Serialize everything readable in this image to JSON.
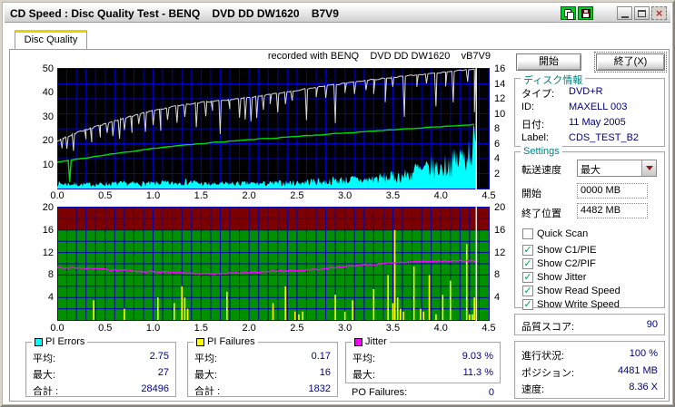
{
  "window": {
    "title": "CD Speed : Disc Quality Test - BENQ    DVD DD DW1620    B7V9"
  },
  "titlebar_icons": [
    "copy-document-icon",
    "save-icon",
    "minimize-icon",
    "maximize-icon",
    "close-icon"
  ],
  "tabs": [
    {
      "label": "Disc Quality"
    }
  ],
  "chart_header": "recorded with BENQ    DVD DD DW1620    vB7V9",
  "actions": {
    "start": "開始",
    "exit": "終了(X)"
  },
  "disc_info": {
    "title": "ディスク情報",
    "rows": [
      {
        "label": "タイプ:",
        "value": "DVD+R"
      },
      {
        "label": "ID:",
        "value": "MAXELL 003"
      },
      {
        "label": "日付:",
        "value": "11 May 2005"
      },
      {
        "label": "Label:",
        "value": "CDS_TEST_B2"
      }
    ]
  },
  "settings": {
    "title": "Settings",
    "speed_label": "転送速度",
    "speed_value": "最大",
    "start_label": "開始",
    "start_value": "0000 MB",
    "end_label": "終了位置",
    "end_value": "4482 MB",
    "checkboxes": [
      {
        "label": "Quick Scan",
        "checked": false
      },
      {
        "label": "Show C1/PIE",
        "checked": true
      },
      {
        "label": "Show C2/PIF",
        "checked": true
      },
      {
        "label": "Show Jitter",
        "checked": true
      },
      {
        "label": "Show Read Speed",
        "checked": true
      },
      {
        "label": "Show Write Speed",
        "checked": true
      }
    ]
  },
  "quality": {
    "label": "品質スコア:",
    "value": "90"
  },
  "progress": {
    "rows": [
      {
        "label": "進行状況:",
        "value": "100 %"
      },
      {
        "label": "ポジション:",
        "value": "4481 MB"
      },
      {
        "label": "速度:",
        "value": "8.36 X"
      }
    ]
  },
  "stats": {
    "pi_errors": {
      "title": "PI Errors",
      "color": "#00ffff",
      "rows": [
        {
          "label": "平均:",
          "value": "2.75"
        },
        {
          "label": "最大:",
          "value": "27"
        },
        {
          "label": "合計 :",
          "value": "28496"
        }
      ]
    },
    "pi_failures": {
      "title": "PI Failures",
      "color": "#ffff00",
      "rows": [
        {
          "label": "平均:",
          "value": "0.17"
        },
        {
          "label": "最大:",
          "value": "16"
        },
        {
          "label": "合計 :",
          "value": "1832"
        }
      ]
    },
    "jitter": {
      "title": "Jitter",
      "color": "#ff00ff",
      "rows": [
        {
          "label": "平均:",
          "value": "9.03 %"
        },
        {
          "label": "最大:",
          "value": "11.3 %"
        }
      ]
    },
    "po_failures": {
      "label": "PO Failures:",
      "value": "0"
    }
  },
  "chart_data": [
    {
      "type": "area",
      "title": "PI Errors / Speed vs position (GB)",
      "x_range": [
        0,
        4.5
      ],
      "end_x": 4.37,
      "x_ticks": [
        "0.0",
        "0.5",
        "1.0",
        "1.5",
        "2.0",
        "2.5",
        "3.0",
        "3.5",
        "4.0",
        "4.5"
      ],
      "left_axis": {
        "range": [
          0,
          50
        ],
        "ticks": [
          50,
          40,
          30,
          20,
          10
        ]
      },
      "right_axis": {
        "range": [
          0,
          16
        ],
        "ticks": [
          16,
          14,
          12,
          10,
          8,
          6,
          4,
          2
        ]
      },
      "grid": {
        "v_step": 0.1,
        "h_step_right": 2,
        "color": "#0000c8"
      },
      "bg": "#000000",
      "series": [
        {
          "name": "PI Errors",
          "type": "noise-area",
          "color": "#00ffff",
          "envelope": [
            [
              0,
              3
            ],
            [
              0.2,
              2.5
            ],
            [
              0.4,
              2.5
            ],
            [
              0.6,
              3
            ],
            [
              0.8,
              3
            ],
            [
              1.0,
              3
            ],
            [
              1.1,
              3.5
            ],
            [
              1.2,
              3
            ],
            [
              1.3,
              4
            ],
            [
              1.4,
              4
            ],
            [
              1.5,
              3
            ],
            [
              1.6,
              2.5
            ],
            [
              1.8,
              3
            ],
            [
              2.0,
              3
            ],
            [
              2.2,
              3
            ],
            [
              2.4,
              3.5
            ],
            [
              2.5,
              3.5
            ],
            [
              2.6,
              4
            ],
            [
              2.7,
              4.5
            ],
            [
              2.8,
              4
            ],
            [
              2.9,
              5
            ],
            [
              3.0,
              5
            ],
            [
              3.1,
              5.5
            ],
            [
              3.2,
              5
            ],
            [
              3.3,
              6
            ],
            [
              3.4,
              6.5
            ],
            [
              3.5,
              7
            ],
            [
              3.6,
              7.5
            ],
            [
              3.7,
              9
            ],
            [
              3.75,
              12
            ],
            [
              3.8,
              10
            ],
            [
              3.9,
              13
            ],
            [
              4.0,
              12
            ],
            [
              4.05,
              14
            ],
            [
              4.1,
              15
            ],
            [
              4.15,
              16
            ],
            [
              4.2,
              18
            ],
            [
              4.25,
              20
            ],
            [
              4.3,
              23
            ],
            [
              4.33,
              25
            ],
            [
              4.36,
              27
            ],
            [
              4.37,
              20
            ]
          ]
        },
        {
          "name": "Read Speed",
          "type": "line",
          "color": "#00dd00",
          "width": 1.4,
          "points": [
            [
              0,
              11
            ],
            [
              0.5,
              14
            ],
            [
              1.0,
              16.8
            ],
            [
              1.5,
              18.8
            ],
            [
              2.0,
              20.4
            ],
            [
              2.5,
              21.8
            ],
            [
              3.0,
              23.2
            ],
            [
              3.5,
              24.6
            ],
            [
              4.0,
              25.8
            ],
            [
              4.37,
              26.8
            ]
          ],
          "spikes": [
            [
              0.13,
              9
            ]
          ]
        },
        {
          "name": "Write Speed",
          "type": "line",
          "color": "#d8d8d8",
          "width": 1,
          "points": [
            [
              0,
              20
            ],
            [
              0.25,
              24
            ],
            [
              0.5,
              27
            ],
            [
              0.75,
              30
            ],
            [
              1.0,
              32.5
            ],
            [
              1.25,
              34.5
            ],
            [
              1.5,
              36
            ],
            [
              1.75,
              37
            ],
            [
              2.0,
              38
            ],
            [
              2.25,
              39.5
            ],
            [
              2.5,
              41
            ],
            [
              2.75,
              42.5
            ],
            [
              3.0,
              44
            ],
            [
              3.25,
              45.3
            ],
            [
              3.5,
              46.5
            ],
            [
              3.75,
              47.5
            ],
            [
              4.0,
              48.5
            ],
            [
              4.2,
              49.3
            ],
            [
              4.37,
              50
            ]
          ],
          "spikes": [
            [
              0.05,
              4
            ],
            [
              0.1,
              5
            ],
            [
              0.17,
              7
            ],
            [
              0.3,
              4
            ],
            [
              0.36,
              6
            ],
            [
              0.45,
              5
            ],
            [
              0.52,
              4
            ],
            [
              0.58,
              6
            ],
            [
              0.65,
              8
            ],
            [
              0.7,
              5
            ],
            [
              0.78,
              7
            ],
            [
              0.85,
              4
            ],
            [
              0.92,
              8
            ],
            [
              1.0,
              6
            ],
            [
              1.08,
              9
            ],
            [
              1.15,
              5
            ],
            [
              1.25,
              7
            ],
            [
              1.33,
              5
            ],
            [
              1.45,
              10
            ],
            [
              1.55,
              6
            ],
            [
              1.62,
              4
            ],
            [
              1.7,
              14
            ],
            [
              1.8,
              4
            ],
            [
              1.9,
              8
            ],
            [
              1.96,
              9
            ],
            [
              2.02,
              10
            ],
            [
              2.08,
              9
            ],
            [
              2.15,
              6
            ],
            [
              2.22,
              4
            ],
            [
              2.3,
              8
            ],
            [
              2.38,
              5
            ],
            [
              2.45,
              4
            ],
            [
              2.6,
              13
            ],
            [
              2.7,
              4
            ],
            [
              2.8,
              5
            ],
            [
              2.9,
              16
            ],
            [
              3.0,
              4
            ],
            [
              3.1,
              5
            ],
            [
              3.22,
              4
            ],
            [
              3.3,
              6
            ],
            [
              3.42,
              10
            ],
            [
              3.5,
              4
            ],
            [
              3.62,
              17
            ],
            [
              3.75,
              5
            ],
            [
              3.85,
              4
            ],
            [
              3.95,
              14
            ],
            [
              4.05,
              6
            ],
            [
              4.13,
              13
            ],
            [
              4.28,
              5
            ],
            [
              4.35,
              18
            ]
          ]
        }
      ]
    },
    {
      "type": "line",
      "title": "PI Failures / Jitter vs position (GB)",
      "x_range": [
        0,
        4.5
      ],
      "end_x": 4.37,
      "x_ticks": [
        "0.0",
        "0.5",
        "1.0",
        "1.5",
        "2.0",
        "2.5",
        "3.0",
        "3.5",
        "4.0",
        "4.5"
      ],
      "y_axis": {
        "range": [
          0,
          20
        ],
        "ticks": [
          20,
          16,
          12,
          8,
          4
        ]
      },
      "grid": {
        "v_step": 0.1,
        "h_step": 2,
        "color": "#0000b4"
      },
      "bg": "#009000",
      "danger_band": [
        16,
        20
      ],
      "band_color": "#7c0000",
      "series": [
        {
          "name": "PI Failures",
          "type": "spikes",
          "color": "#ffff00",
          "spikes": [
            [
              0.38,
              3.5
            ],
            [
              0.7,
              2
            ],
            [
              1.05,
              4
            ],
            [
              1.22,
              3
            ],
            [
              1.3,
              6
            ],
            [
              1.33,
              4
            ],
            [
              1.36,
              2
            ],
            [
              1.77,
              5
            ],
            [
              2.25,
              3
            ],
            [
              2.38,
              6
            ],
            [
              2.48,
              1.5
            ],
            [
              2.52,
              1
            ],
            [
              2.56,
              1.5
            ],
            [
              2.9,
              4.5
            ],
            [
              3.0,
              1.5
            ],
            [
              3.08,
              3.5
            ],
            [
              3.3,
              5.5
            ],
            [
              3.45,
              8
            ],
            [
              3.5,
              3
            ],
            [
              3.52,
              16
            ],
            [
              3.55,
              4
            ],
            [
              3.58,
              2
            ],
            [
              3.61,
              1.5
            ],
            [
              3.72,
              9.5
            ],
            [
              3.79,
              2
            ],
            [
              3.82,
              1.5
            ],
            [
              3.88,
              8
            ],
            [
              3.95,
              1
            ],
            [
              4.02,
              4.5
            ],
            [
              4.1,
              7
            ],
            [
              4.27,
              13.5
            ],
            [
              4.3,
              1
            ],
            [
              4.33,
              1
            ],
            [
              4.35,
              4
            ]
          ]
        },
        {
          "name": "Jitter",
          "type": "line",
          "color": "#ff00ff",
          "width": 1.4,
          "points": [
            [
              0,
              9.3
            ],
            [
              0.2,
              9.25
            ],
            [
              0.4,
              9.1
            ],
            [
              0.6,
              8.9
            ],
            [
              0.8,
              8.7
            ],
            [
              1.0,
              8.55
            ],
            [
              1.2,
              8.45
            ],
            [
              1.4,
              8.3
            ],
            [
              1.5,
              8.2
            ],
            [
              1.7,
              8.25
            ],
            [
              1.9,
              8.4
            ],
            [
              2.1,
              8.55
            ],
            [
              2.3,
              8.7
            ],
            [
              2.5,
              8.8
            ],
            [
              2.7,
              9.0
            ],
            [
              2.9,
              9.3
            ],
            [
              3.1,
              9.7
            ],
            [
              3.3,
              9.9
            ],
            [
              3.5,
              10.2
            ],
            [
              3.7,
              10.35
            ],
            [
              3.9,
              10.45
            ],
            [
              4.1,
              10.5
            ],
            [
              4.3,
              10.55
            ],
            [
              4.37,
              10.5
            ]
          ]
        }
      ]
    }
  ]
}
